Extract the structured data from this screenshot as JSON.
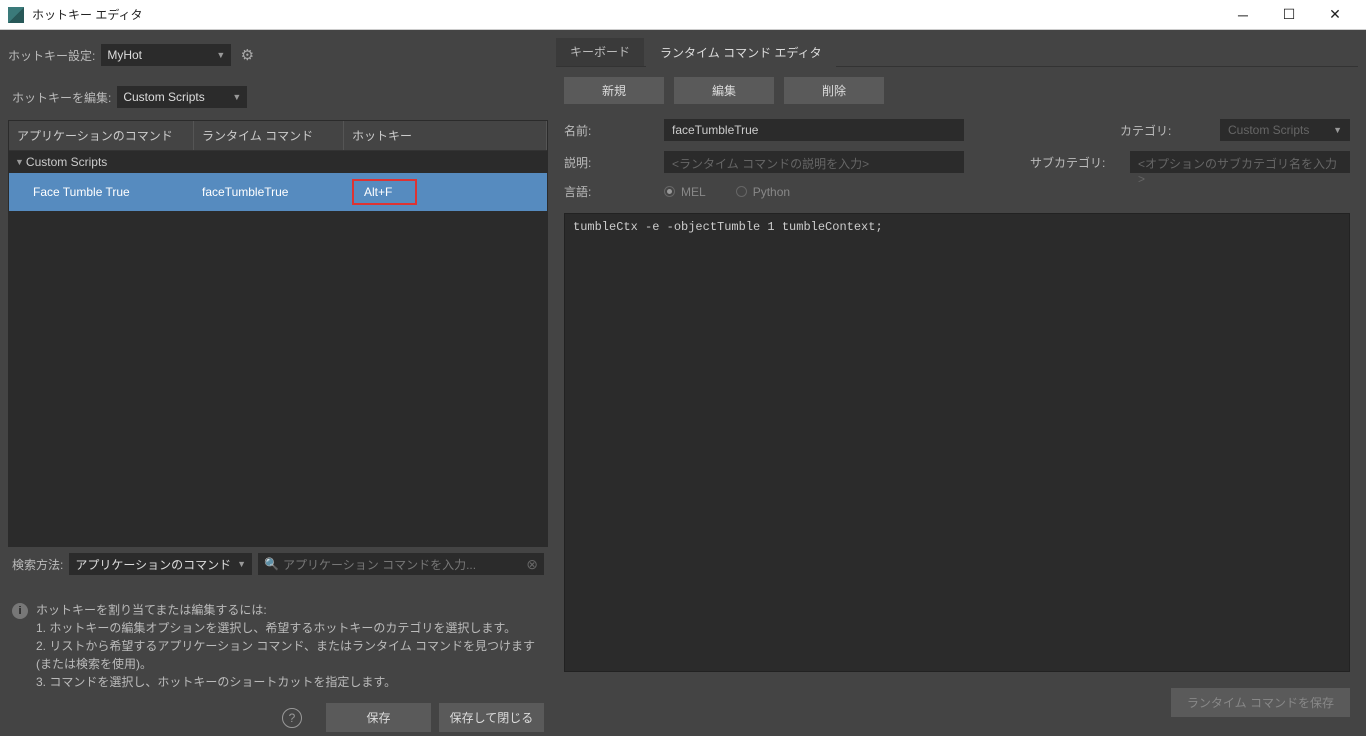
{
  "window": {
    "title": "ホットキー エディタ"
  },
  "left": {
    "hotkeySettingLabel": "ホットキー設定:",
    "hotkeySettingValue": "MyHot",
    "editLabel": "ホットキーを編集:",
    "editValue": "Custom Scripts",
    "columns": {
      "app": "アプリケーションのコマンド",
      "runtime": "ランタイム コマンド",
      "hotkey": "ホットキー"
    },
    "categoryName": "Custom Scripts",
    "row": {
      "app": "Face Tumble True",
      "runtime": "faceTumbleTrue",
      "hotkey": "Alt+F"
    },
    "searchLabel": "検索方法:",
    "searchType": "アプリケーションのコマンド",
    "searchPlaceholder": "アプリケーション コマンドを入力...",
    "info": {
      "title": "ホットキーを割り当てまたは編集するには:",
      "line1": "1. ホットキーの編集オプションを選択し、希望するホットキーのカテゴリを選択します。",
      "line2": "2. リストから希望するアプリケーション コマンド、またはランタイム コマンドを見つけます(または検索を使用)。",
      "line3": "3. コマンドを選択し、ホットキーのショートカットを指定します。"
    },
    "buttons": {
      "save": "保存",
      "saveClose": "保存して閉じる"
    }
  },
  "right": {
    "tabs": {
      "keyboard": "キーボード",
      "runtime": "ランタイム コマンド エディタ"
    },
    "actions": {
      "new": "新規",
      "edit": "編集",
      "delete": "削除"
    },
    "form": {
      "nameLabel": "名前:",
      "nameValue": "faceTumbleTrue",
      "categoryLabel": "カテゴリ:",
      "categoryValue": "Custom Scripts",
      "descLabel": "説明:",
      "descPlaceholder": "<ランタイム コマンドの説明を入力>",
      "subcategoryLabel": "サブカテゴリ:",
      "subcategoryPlaceholder": "<オプションのサブカテゴリ名を入力>",
      "langLabel": "言語:",
      "langMel": "MEL",
      "langPython": "Python"
    },
    "code": "tumbleCtx -e -objectTumble 1 tumbleContext;",
    "saveRuntime": "ランタイム コマンドを保存"
  }
}
